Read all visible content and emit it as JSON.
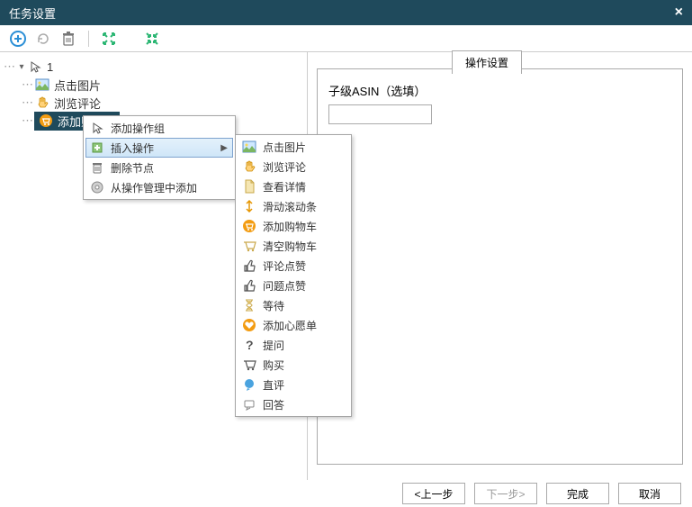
{
  "window": {
    "title": "任务设置",
    "close": "×"
  },
  "toolbar_icons": [
    "add",
    "refresh",
    "delete",
    "expand",
    "collapse"
  ],
  "tree": {
    "root_label": "1",
    "children": [
      {
        "icon": "image",
        "label": "点击图片"
      },
      {
        "icon": "hand",
        "label": "浏览评论"
      },
      {
        "icon": "cart",
        "label": "添加购物车",
        "selected": true
      }
    ]
  },
  "context_menu": {
    "items": [
      {
        "icon": "cursor",
        "label": "添加操作组"
      },
      {
        "icon": "insert",
        "label": "插入操作",
        "hasSubmenu": true,
        "hover": true
      },
      {
        "icon": "trash",
        "label": "删除节点"
      },
      {
        "icon": "disc",
        "label": "从操作管理中添加"
      }
    ]
  },
  "submenu": {
    "items": [
      {
        "icon": "image",
        "label": "点击图片"
      },
      {
        "icon": "hand",
        "label": "浏览评论"
      },
      {
        "icon": "doc",
        "label": "查看详情"
      },
      {
        "icon": "scroll",
        "label": "滑动滚动条"
      },
      {
        "icon": "cart",
        "label": "添加购物车"
      },
      {
        "icon": "cart-empty",
        "label": "清空购物车"
      },
      {
        "icon": "thumb",
        "label": "评论点赞"
      },
      {
        "icon": "thumb",
        "label": "问题点赞"
      },
      {
        "icon": "hourglass",
        "label": "等待"
      },
      {
        "icon": "heart",
        "label": "添加心愿单"
      },
      {
        "icon": "question",
        "label": "提问"
      },
      {
        "icon": "buy",
        "label": "购买"
      },
      {
        "icon": "chat",
        "label": "直评"
      },
      {
        "icon": "reply",
        "label": "回答"
      }
    ]
  },
  "right_panel": {
    "group_title": "操作设置",
    "field_label": "子级ASIN（选填）",
    "field_value": ""
  },
  "footer": {
    "prev": "<上一步",
    "next": "下一步>",
    "finish": "完成",
    "cancel": "取消"
  }
}
